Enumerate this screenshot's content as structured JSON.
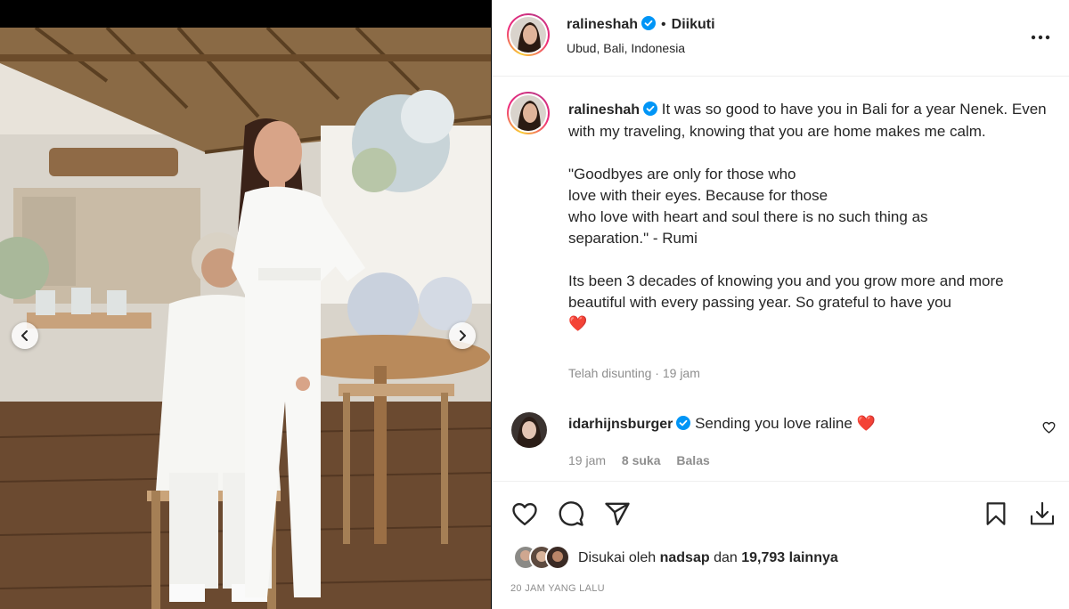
{
  "post": {
    "username": "ralineshah",
    "separator": "•",
    "follow_status": "Diikuti",
    "location": "Ubud, Bali, Indonesia"
  },
  "caption": {
    "username": "ralineshah",
    "line1": "It was so good to have you in Bali for a year Nenek. Even with my traveling, knowing that you are home makes me calm.",
    "quote_l1": "\"Goodbyes are only for those who",
    "quote_l2": "love with their eyes. Because for those",
    "quote_l3": "who love with heart and soul there is no such thing as",
    "quote_l4": "separation.\" - Rumi",
    "closing": "Its been 3 decades of knowing you and you grow more and more beautiful with every passing year. So grateful to have you",
    "heart": "❤️",
    "edited": "Telah disunting",
    "meta_separator": "·",
    "time": "19 jam"
  },
  "comment": {
    "username": "idarhijnsburger",
    "text": "Sending you love raline",
    "heart": "❤️",
    "time": "19 jam",
    "likes": "8 suka",
    "reply": "Balas"
  },
  "likes": {
    "prefix": "Disukai oleh",
    "user": "nadsap",
    "conj": "dan",
    "count": "19,793",
    "suffix": "lainnya"
  },
  "timestamp": "20 JAM YANG LALU",
  "icons": {
    "verified": "verified-badge-icon",
    "more": "more-options-icon",
    "like": "heart-icon",
    "comment": "comment-icon",
    "share": "share-icon",
    "save": "bookmark-icon",
    "download": "download-icon"
  },
  "colors": {
    "verified_blue": "#0095f6",
    "heart_red": "#ed4956",
    "muted_text": "#8e8e8e",
    "primary_text": "#262626"
  }
}
